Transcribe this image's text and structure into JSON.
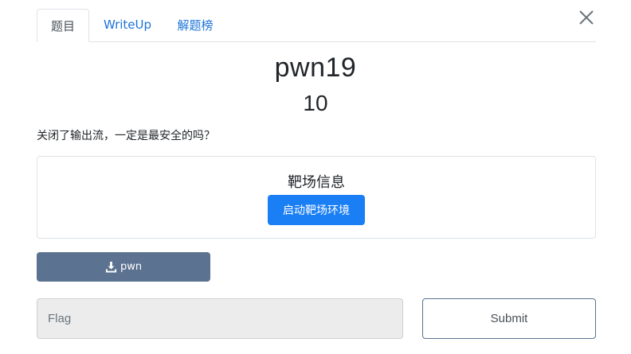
{
  "tabs": [
    {
      "label": "题目",
      "active": true
    },
    {
      "label": "WriteUp",
      "active": false
    },
    {
      "label": "解题榜",
      "active": false
    }
  ],
  "challenge": {
    "name": "pwn19",
    "points": "10",
    "description": "关闭了输出流，一定是最安全的吗？"
  },
  "target": {
    "title": "靶场信息",
    "start_label": "启动靶场环境"
  },
  "download": {
    "label": "pwn",
    "icon": "download-icon"
  },
  "flag": {
    "value": "",
    "placeholder": "Flag"
  },
  "submit_label": "Submit",
  "colors": {
    "link": "#1a73d9",
    "primary": "#1a7ef5",
    "secondary": "#5b7290"
  }
}
